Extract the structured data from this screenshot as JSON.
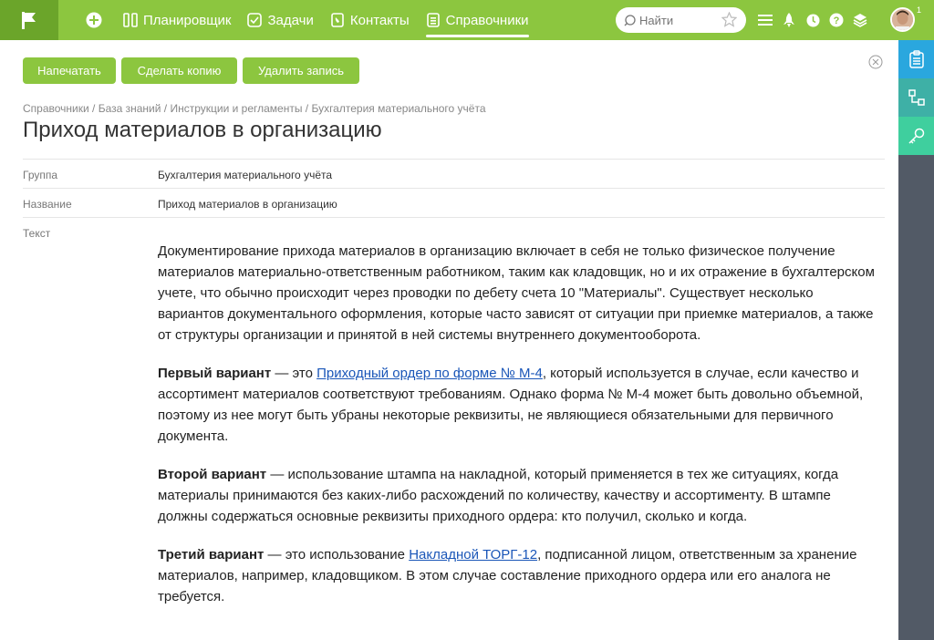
{
  "topbar": {
    "nav": [
      {
        "label": "Планировщик",
        "icon": "columns-icon"
      },
      {
        "label": "Задачи",
        "icon": "checkbox-icon"
      },
      {
        "label": "Контакты",
        "icon": "phone-book-icon"
      },
      {
        "label": "Справочники",
        "icon": "list-book-icon",
        "active": true
      }
    ],
    "search_placeholder": "Найти",
    "avatar_badge": "1"
  },
  "toolbar": {
    "print_label": "Напечатать",
    "copy_label": "Сделать копию",
    "delete_label": "Удалить запись"
  },
  "breadcrumb": "Справочники / База знаний / Инструкции и регламенты / Бухгалтерия материального учёта",
  "page_title": "Приход материалов в организацию",
  "fields": {
    "group_label": "Группа",
    "group_value": "Бухгалтерия материального учёта",
    "name_label": "Название",
    "name_value": "Приход материалов в организацию",
    "text_label": "Текст"
  },
  "article": {
    "p1": "Документирование прихода материалов в организацию включает в себя не только физическое получение материалов материально-ответственным работником, таким как кладовщик, но и их отражение в бухгалтерском учете, что обычно происходит через проводки по дебету счета 10 \"Материалы\". Существует несколько вариантов документального оформления, которые часто зависят от ситуации при приемке материалов, а также от структуры организации и принятой в ней системы внутреннего документооборота.",
    "p2_bold": "Первый вариант",
    "p2_pre": " — это ",
    "p2_link": "Приходный ордер по форме № М-4",
    "p2_post": ", который используется в случае, если качество и ассортимент материалов соответствуют требованиям. Однако форма № М-4 может быть довольно объемной, поэтому из нее могут быть убраны некоторые реквизиты, не являющиеся обязательными для первичного документа.",
    "p3_bold": "Второй вариант",
    "p3_text": " — использование штампа на накладной, который применяется в тех же ситуациях, когда материалы принимаются без каких-либо расхождений по количеству, качеству и ассортименту. В штампе должны содержаться основные реквизиты приходного ордера: кто получил, сколько и когда.",
    "p4_bold": "Третий вариант",
    "p4_pre": " — это использование ",
    "p4_link": "Накладной ТОРГ-12",
    "p4_post": ", подписанной лицом, ответственным за хранение материалов, например, кладовщиком. В этом случае составление приходного ордера или его аналога не требуется."
  },
  "colors": {
    "topbar": "#8cc63f",
    "logo_bg": "#6ba52a",
    "rightbar": "#525a66",
    "rb_blue": "#2aa7de",
    "rb_teal": "#3eb0a6",
    "rb_green": "#3fcf9e",
    "link": "#1a56b8"
  }
}
